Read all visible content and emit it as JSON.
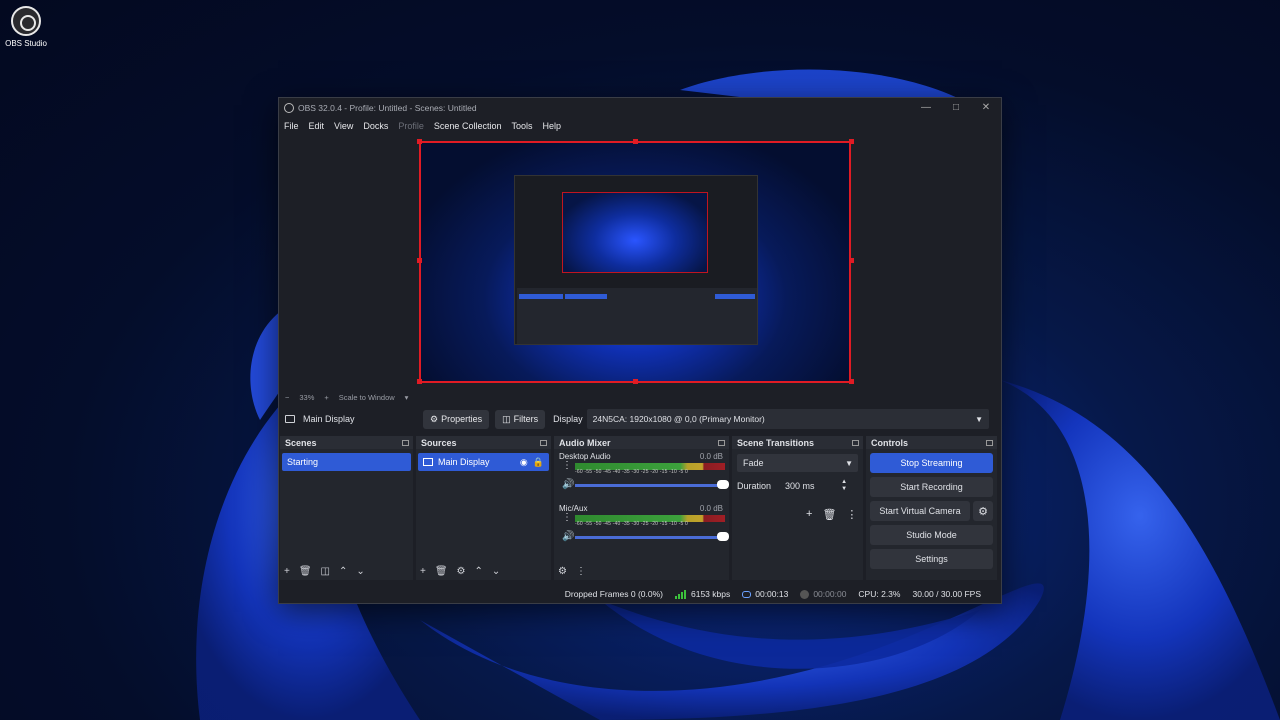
{
  "desktop": {
    "icon_label": "OBS Studio"
  },
  "window": {
    "title": "OBS 32.0.4 - Profile: Untitled - Scenes: Untitled",
    "menu": [
      "File",
      "Edit",
      "View",
      "Docks",
      "Profile",
      "Scene Collection",
      "Tools",
      "Help"
    ],
    "disabled_menu": "Profile"
  },
  "zoom": {
    "minus": "−",
    "level": "33%",
    "plus": "+",
    "mode": "Scale to Window",
    "caret": "▾"
  },
  "source_toolbar": {
    "source_name": "Main Display",
    "properties_label": "Properties",
    "filters_label": "Filters",
    "display_label": "Display",
    "display_value": "24N5CA: 1920x1080 @ 0,0 (Primary Monitor)"
  },
  "scenes": {
    "title": "Scenes",
    "items": [
      "Starting"
    ]
  },
  "sources": {
    "title": "Sources",
    "items": [
      "Main Display"
    ]
  },
  "audio_mixer": {
    "title": "Audio Mixer",
    "ticks": "-60 -55 -50 -45 -40 -35 -30 -25 -20 -15 -10 -5 0",
    "channels": [
      {
        "name": "Desktop Audio",
        "db": "0.0 dB"
      },
      {
        "name": "Mic/Aux",
        "db": "0.0 dB"
      }
    ]
  },
  "scene_transitions": {
    "title": "Scene Transitions",
    "transition": "Fade",
    "duration_label": "Duration",
    "duration_value": "300 ms"
  },
  "controls": {
    "title": "Controls",
    "stop_streaming": "Stop Streaming",
    "start_recording": "Start Recording",
    "start_virtual_camera": "Start Virtual Camera",
    "studio_mode": "Studio Mode",
    "settings": "Settings"
  },
  "status": {
    "dropped_frames": "Dropped Frames 0 (0.0%)",
    "bitrate": "6153 kbps",
    "stream_time": "00:00:13",
    "record_time": "00:00:00",
    "cpu": "CPU: 2.3%",
    "fps": "30.00 / 30.00 FPS"
  },
  "colors": {
    "accent": "#2f5bd6",
    "selection_border": "#e01b24",
    "window_bg": "#1d1f26",
    "dock_bg": "#23262d"
  }
}
